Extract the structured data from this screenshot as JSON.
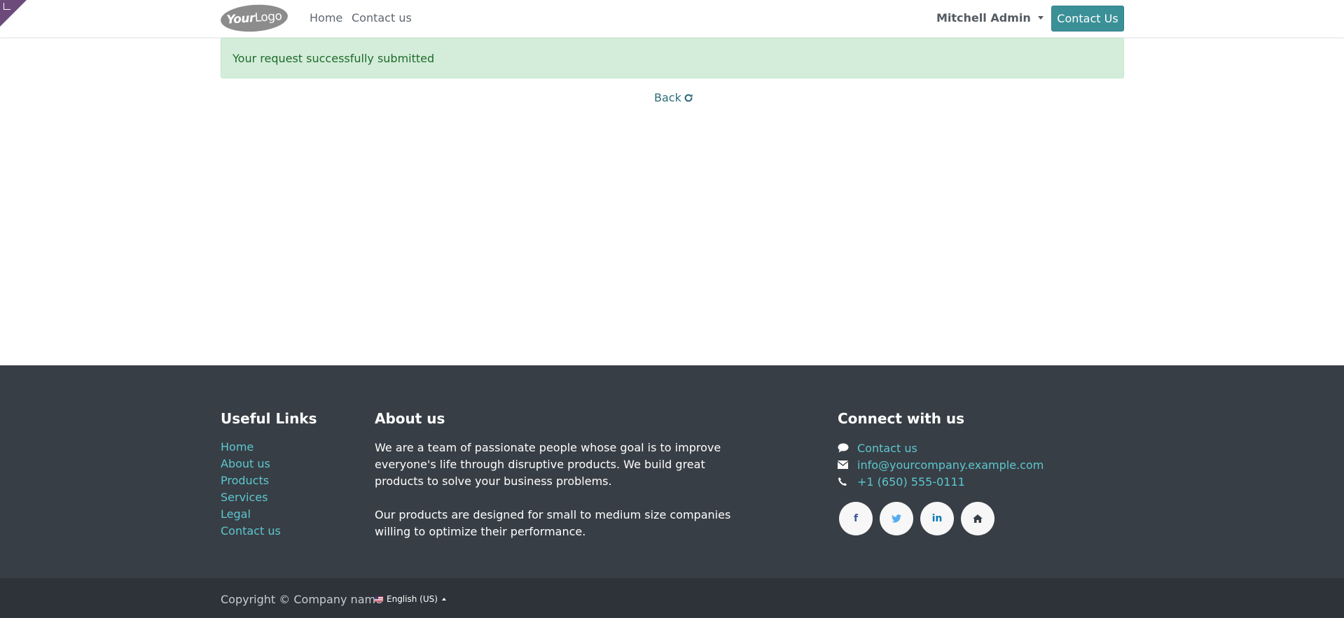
{
  "header": {
    "logo": {
      "prefix": "Your",
      "suffix": "Logo"
    },
    "nav": [
      {
        "label": "Home"
      },
      {
        "label": "Contact us"
      }
    ],
    "user_name": "Mitchell Admin",
    "cta_label": "Contact Us"
  },
  "main": {
    "alert_text": "Your request successfully submitted",
    "back_label": "Back",
    "back_icon": "refresh-icon"
  },
  "footer": {
    "useful_links": {
      "title": "Useful Links",
      "items": [
        "Home",
        "About us",
        "Products",
        "Services",
        "Legal",
        "Contact us"
      ]
    },
    "about": {
      "title": "About us",
      "paragraphs": [
        "We are a team of passionate people whose goal is to improve everyone's life through disruptive products. We build great products to solve your business problems.",
        "Our products are designed for small to medium size companies willing to optimize their performance."
      ]
    },
    "connect": {
      "title": "Connect with us",
      "items": [
        {
          "icon": "comment-icon",
          "text": "Contact us"
        },
        {
          "icon": "envelope-icon",
          "text": "info@yourcompany.example.com"
        },
        {
          "icon": "phone-icon",
          "text": "+1 (650) 555-0111"
        }
      ],
      "socials": [
        {
          "icon": "facebook-icon",
          "glyph": "f",
          "color": "#3b5998"
        },
        {
          "icon": "twitter-icon",
          "glyph": "🐦",
          "color": "#55acee"
        },
        {
          "icon": "linkedin-icon",
          "glyph": "in",
          "color": "#0077b5"
        },
        {
          "icon": "home-icon",
          "glyph": "⌂",
          "color": "#383e45"
        }
      ]
    }
  },
  "bottom": {
    "copyright": "Copyright © Company name",
    "language": "English (US)"
  },
  "colors": {
    "primary": "#3b9098",
    "link": "#5cc7d0",
    "footer_bg": "#383e45",
    "bottom_bg": "#2e333a",
    "alert_bg": "#d4edda",
    "alert_text": "#1e6b2a"
  }
}
